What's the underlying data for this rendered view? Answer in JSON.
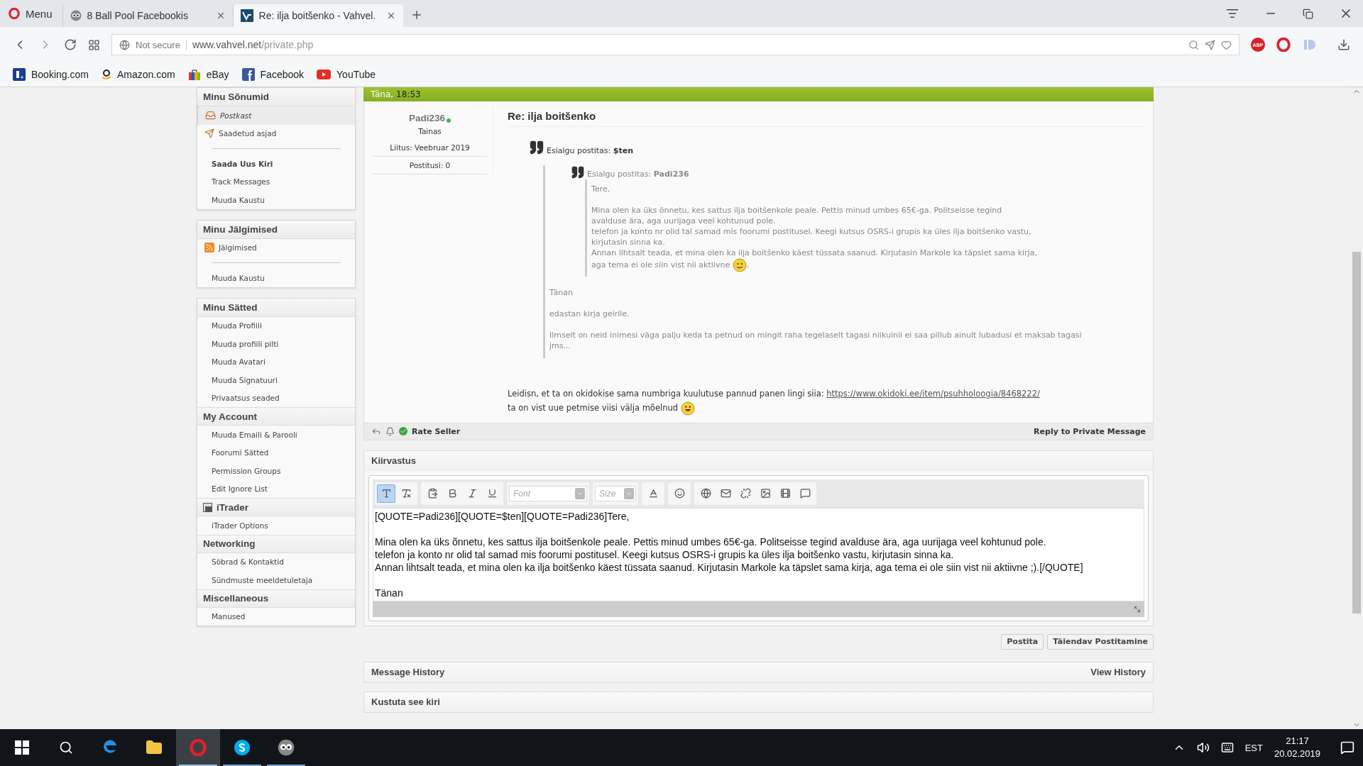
{
  "browser": {
    "menu_label": "Menu",
    "tabs": [
      {
        "label": "8 Ball Pool Facebookis",
        "selected": false,
        "kind": "game"
      },
      {
        "label": "Re: ilja boitšenko - Vahvel.",
        "selected": true,
        "kind": "site"
      }
    ],
    "address": {
      "security": "Not secure",
      "host": "www.vahvel.net",
      "path": "/private.php"
    },
    "adblock_label": "ABP",
    "bookmarks": [
      {
        "label": "Booking.com",
        "kind": "square"
      },
      {
        "label": "Amazon.com",
        "kind": "smile"
      },
      {
        "label": "eBay",
        "kind": "bag"
      },
      {
        "label": "Facebook",
        "kind": "page"
      },
      {
        "label": "YouTube",
        "kind": "play"
      }
    ]
  },
  "sidebar": {
    "sections": [
      {
        "groups": [
          {
            "title": "Minu Sõnumid",
            "kind": "plain",
            "items": [
              {
                "kind": "inbox",
                "label": "Postkast",
                "selected": true
              },
              {
                "kind": "sent",
                "label": "Saadetud asjad",
                "selected": false
              },
              {
                "kind": "divider"
              },
              {
                "kind": "bold",
                "label": "Saada Uus Kiri",
                "selected": false
              },
              {
                "kind": "link",
                "label": "Track Messages",
                "selected": false
              },
              {
                "kind": "link",
                "label": "Muuda Kaustu",
                "selected": false
              }
            ]
          }
        ]
      },
      {
        "groups": [
          {
            "title": "Minu Jälgimised",
            "kind": "plain",
            "items": [
              {
                "kind": "rss",
                "label": "Jälgimised",
                "selected": false
              },
              {
                "kind": "divider"
              },
              {
                "kind": "link",
                "label": "Muuda Kaustu",
                "selected": false
              }
            ]
          }
        ]
      },
      {
        "groups": [
          {
            "title": "Minu Sätted",
            "kind": "plain",
            "items": [
              {
                "kind": "link",
                "label": "Muuda Profiili",
                "selected": false
              },
              {
                "kind": "link",
                "label": "Muuda profiili pilti",
                "selected": false
              },
              {
                "kind": "link",
                "label": "Muuda Avatari",
                "selected": false
              },
              {
                "kind": "link",
                "label": "Muuda Signatuuri",
                "selected": false
              },
              {
                "kind": "link",
                "label": "Privaatsus seaded",
                "selected": false
              }
            ]
          },
          {
            "title": "My Account",
            "kind": "plain",
            "items": [
              {
                "kind": "link",
                "label": "Muuda Emaili & Parooli",
                "selected": false
              },
              {
                "kind": "link",
                "label": "Foorumi Sätted",
                "selected": false
              },
              {
                "kind": "link",
                "label": "Permission Groups",
                "selected": false
              },
              {
                "kind": "link",
                "label": "Edit Ignore List",
                "selected": false
              }
            ]
          },
          {
            "title": "iTrader",
            "kind": "icon",
            "items": [
              {
                "kind": "link",
                "label": "iTrader Options",
                "selected": false
              }
            ]
          },
          {
            "title": "Networking",
            "kind": "plain",
            "items": [
              {
                "kind": "link",
                "label": "Sõbrad & Kontaktid",
                "selected": false
              },
              {
                "kind": "link",
                "label": "Sündmuste meeldetuletaja",
                "selected": false
              }
            ]
          },
          {
            "title": "Miscellaneous",
            "kind": "plain",
            "items": [
              {
                "kind": "link",
                "label": "Manused",
                "selected": false
              }
            ]
          }
        ]
      }
    ]
  },
  "message": {
    "date": "Täna,",
    "time": "18:53",
    "author": {
      "name": "Padi236",
      "online": true,
      "title": "Tainas",
      "joined": "Liitus: Veebruar 2019",
      "posts": "Postitusi: 0"
    },
    "title": "Re: ilja boitšenko",
    "quote": {
      "label": "Esialgu postitas:",
      "author": "$ten",
      "nested": {
        "label": "Esialgu postitas:",
        "author": "Padi236",
        "blocks": [
          [
            {
              "kind": "plain",
              "text": "Tere,"
            }
          ],
          [
            {
              "kind": "plain",
              "text": "Mina olen ka üks õnnetu, kes sattus ilja boitšenkole peale. Pettis minud umbes 65€-ga. Politseisse tegind avalduse ära, aga uurijaga veel kohtunud pole."
            },
            {
              "kind": "plain",
              "text": "telefon ja konto nr olid tal samad mis foorumi postitusel. Keegi kutsus OSRS-i grupis ka üles ilja boitšenko vastu, kirjutasin sinna ka."
            },
            {
              "kind": "wink",
              "text": "Annan lihtsalt teada, et mina olen ka ilja boitšenko käest tüssata saanud. Kirjutasin Markole ka täpslet sama kirja, aga tema ei ole siin vist nii aktiivne",
              "tail": "."
            }
          ]
        ]
      },
      "paragraphs": [
        "Tänan",
        "edastan kirja geirile.",
        "Ilmselt on neid inimesi väga palju keda ta petnud on mingit raha tegelaselt tagasi niikuinii ei saa pillub ainult lubadusi et maksab tagasi jms..."
      ]
    },
    "body": [
      {
        "kind": "plain",
        "text": "Leidisn, et ta on okidokise sama numbriga kuulutuse pannud panen lingi siia:",
        "link": "https://www.okidoki.ee/item/psuhholoogia/8468222/"
      },
      {
        "kind": "grin",
        "text": "ta on vist uue petmise viisi välja mõelnud"
      }
    ],
    "rate_label": "Rate Seller",
    "reply_label": "Reply to Private Message"
  },
  "quick_reply": {
    "title": "Kiirvastus",
    "toolbar": [
      [
        {
          "kind": "mode",
          "selected": true
        },
        {
          "kind": "clear",
          "selected": false
        }
      ],
      [
        {
          "kind": "paste",
          "selected": false
        },
        {
          "kind": "bold",
          "selected": false
        },
        {
          "kind": "italic",
          "selected": false
        },
        {
          "kind": "underline",
          "selected": false
        }
      ],
      [
        {
          "kind": "font",
          "placeholder": "Font"
        }
      ],
      [
        {
          "kind": "size",
          "placeholder": "Size"
        }
      ],
      [
        {
          "kind": "color",
          "selected": false
        }
      ],
      [
        {
          "kind": "smilie",
          "selected": false
        }
      ],
      [
        {
          "kind": "link",
          "selected": false
        },
        {
          "kind": "email",
          "selected": false
        },
        {
          "kind": "unlink",
          "selected": false
        },
        {
          "kind": "image",
          "selected": false
        },
        {
          "kind": "video",
          "selected": false
        },
        {
          "kind": "quote",
          "selected": false
        }
      ]
    ],
    "value": "[QUOTE=Padi236][QUOTE=$ten][QUOTE=Padi236]Tere,\n\nMina olen ka üks õnnetu, kes sattus ilja boitšenkole peale. Pettis minud umbes 65€-ga. Politseisse tegind avalduse ära, aga uurijaga veel kohtunud pole.\ntelefon ja konto nr olid tal samad mis foorumi postitusel. Keegi kutsus OSRS-i grupis ka üles ilja boitšenko vastu, kirjutasin sinna ka.\nAnnan lihtsalt teada, et mina olen ka ilja boitšenko käest tüssata saanud. Kirjutasin Markole ka täpslet sama kirja, aga tema ei ole siin vist nii aktiivne ;).[/QUOTE]\n\nTänan",
    "buttons": [
      "Postita",
      "Täiendav Postitamine"
    ]
  },
  "history": {
    "title": "Message History",
    "action": "View History"
  },
  "delete": {
    "title": "Kustuta see kiri"
  },
  "taskbar": {
    "apps": [
      {
        "kind": "edge",
        "active": false,
        "running": false
      },
      {
        "kind": "folder",
        "active": false,
        "running": false
      },
      {
        "kind": "opera",
        "active": true,
        "running": true
      },
      {
        "kind": "skype",
        "active": false,
        "running": true
      },
      {
        "kind": "game",
        "active": false,
        "running": true
      }
    ],
    "language": "EST",
    "time": "21:17",
    "date": "20.02.2019"
  }
}
